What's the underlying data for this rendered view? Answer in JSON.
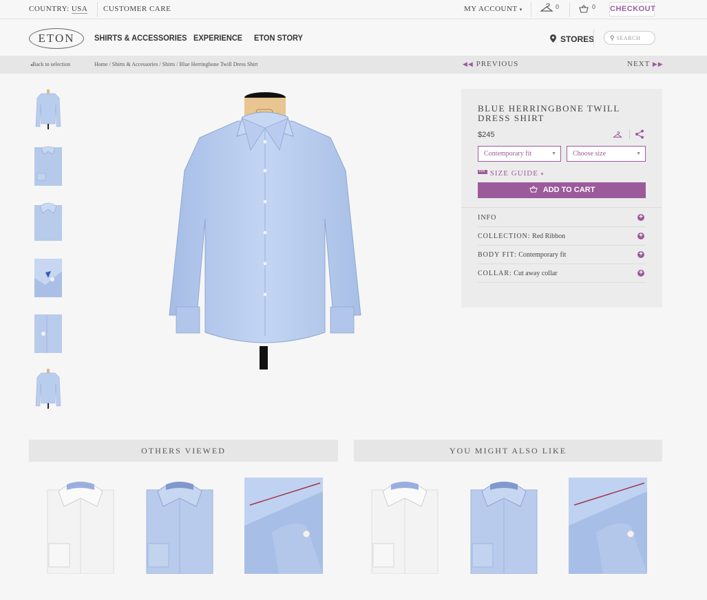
{
  "topbar": {
    "country_label": "COUNTRY:",
    "country_value": "USA",
    "customer_care": "CUSTOMER CARE",
    "my_account": "MY ACCOUNT",
    "wishlist_count": "0",
    "cart_count": "0",
    "checkout": "CHECKOUT"
  },
  "nav": {
    "logo": "ETON",
    "items": [
      "SHIRTS & ACCESSORIES",
      "EXPERIENCE",
      "ETON STORY"
    ],
    "stores": "STORES",
    "search_placeholder": "SEARCH"
  },
  "breadcrumb": {
    "back": "Back to selection",
    "path": "Home / Shirts & Accessories / Shirts / Blue Herringbone Twill Dress Shirt",
    "previous": "PREVIOUS",
    "next": "NEXT"
  },
  "product": {
    "title": "BLUE HERRINGBONE TWILL DRESS SHIRT",
    "price": "$245",
    "fit_select": "Contemporary fit",
    "size_select": "Choose size",
    "size_guide": "SIZE GUIDE",
    "add_to_cart": "ADD TO CART",
    "mannequin_label": "ETON",
    "details": [
      {
        "label": "INFO",
        "value": ""
      },
      {
        "label": "COLLECTION:",
        "value": "Red Ribbon"
      },
      {
        "label": "BODY FIT:",
        "value": "Contemporary fit"
      },
      {
        "label": "COLLAR:",
        "value": "Cut away collar"
      }
    ]
  },
  "sections": {
    "others_viewed": "OTHERS VIEWED",
    "you_might_like": "YOU MIGHT ALSO LIKE"
  },
  "icons": [
    "chevron-down-icon",
    "hanger-icon",
    "basket-icon",
    "map-pin-icon",
    "search-icon",
    "double-left-icon",
    "double-right-icon",
    "share-icon",
    "ruler-icon",
    "plus-circle-icon"
  ],
  "colors": {
    "accent": "#9b5b9b",
    "shirt_blue": "#b4c8ec",
    "shirt_white": "#f4f4f4"
  }
}
